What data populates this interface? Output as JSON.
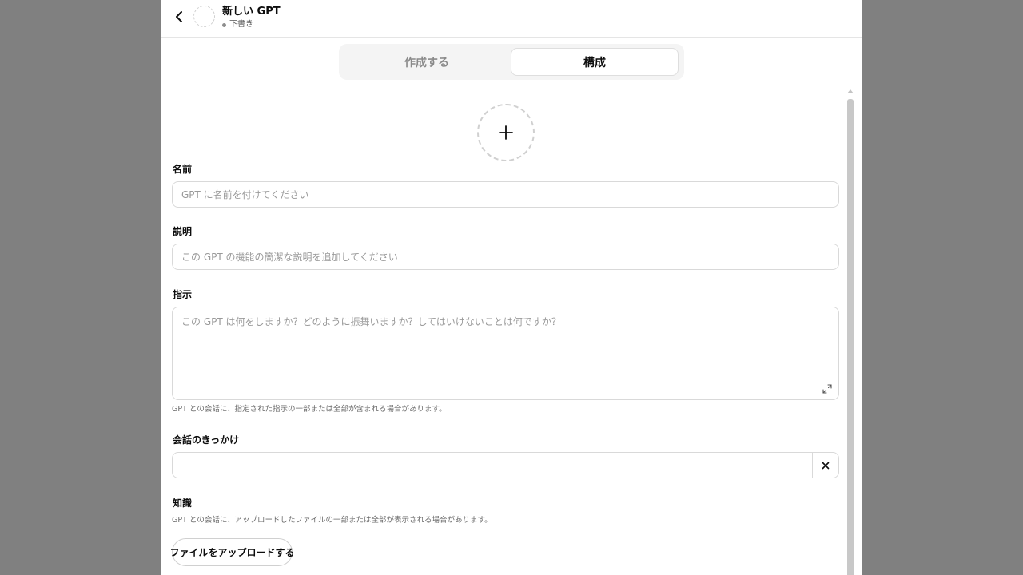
{
  "header": {
    "title": "新しい GPT",
    "status": "下書き"
  },
  "tabs": [
    {
      "label": "作成する",
      "active": false
    },
    {
      "label": "構成",
      "active": true
    }
  ],
  "form": {
    "name": {
      "label": "名前",
      "value": "",
      "placeholder": "GPT に名前を付けてください"
    },
    "description": {
      "label": "説明",
      "value": "",
      "placeholder": "この GPT の機能の簡潔な説明を追加してください"
    },
    "instructions": {
      "label": "指示",
      "value": "",
      "placeholder": "この GPT は何をしますか？どのように振舞いますか？してはいけないことは何ですか？",
      "hint": "GPT との会話に、指定された指示の一部または全部が含まれる場合があります。"
    },
    "conversation_starters": {
      "label": "会話のきっかけ",
      "value": "",
      "clear_icon": "close-icon"
    },
    "knowledge": {
      "label": "知識",
      "hint": "GPT との会話に、アップロードしたファイルの一部または全部が表示される場合があります。",
      "upload_label": "ファイルをアップロードする"
    }
  },
  "icons": {
    "back": "chevron-left-icon",
    "add_image": "plus-icon",
    "expand": "expand-icon"
  },
  "colors": {
    "backdrop": "#808080",
    "panel": "#ffffff",
    "border": "#d9d9d9",
    "placeholder": "#9a9a9a"
  }
}
